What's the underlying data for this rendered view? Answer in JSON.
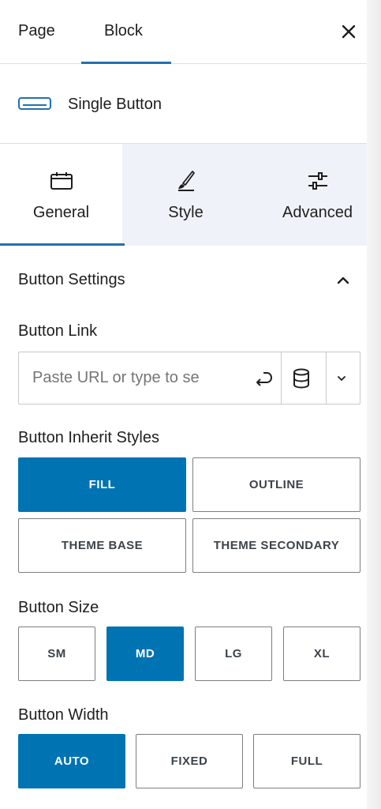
{
  "top_tabs": {
    "page": "Page",
    "block": "Block",
    "close_icon": "close-icon"
  },
  "block_header": {
    "icon": "button-icon",
    "title": "Single Button"
  },
  "sub_tabs": [
    {
      "label": "General",
      "icon": "calendar-icon",
      "active": true
    },
    {
      "label": "Style",
      "icon": "brush-icon",
      "active": false
    },
    {
      "label": "Advanced",
      "icon": "sliders-icon",
      "active": false
    }
  ],
  "section": {
    "title": "Button Settings",
    "collapse_icon": "chevron-up-icon"
  },
  "button_link": {
    "label": "Button Link",
    "placeholder": "Paste URL or type to se",
    "value": ""
  },
  "inherit_styles": {
    "label": "Button Inherit Styles",
    "options": [
      "FILL",
      "OUTLINE",
      "THEME BASE",
      "THEME SECONDARY"
    ],
    "selected": "FILL"
  },
  "size": {
    "label": "Button Size",
    "options": [
      "SM",
      "MD",
      "LG",
      "XL"
    ],
    "selected": "MD"
  },
  "width": {
    "label": "Button Width",
    "options": [
      "AUTO",
      "FIXED",
      "FULL"
    ],
    "selected": "AUTO"
  },
  "colors": {
    "accent": "#0073b3",
    "tab_underline": "#2271b1",
    "tab_bg": "#eff2f8"
  }
}
